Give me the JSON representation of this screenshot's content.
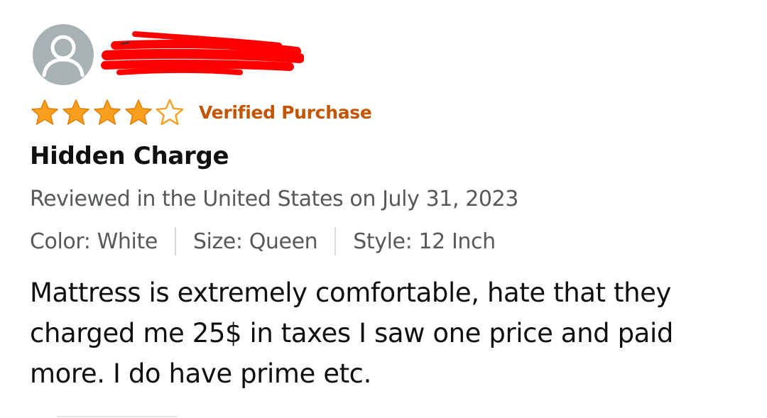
{
  "review": {
    "rating": 4,
    "rating_max": 5,
    "verified_label": "Verified Purchase",
    "title": "Hidden Charge",
    "reviewed_line": "Reviewed in the United States on July 31, 2023",
    "variations": {
      "color": "Color: White",
      "size": "Size: Queen",
      "style": "Style: 12 Inch"
    },
    "body": "Mattress is extremely comfortable, hate that they charged me 25$ in taxes I saw one price and paid more. I do have prime etc."
  },
  "colors": {
    "star": "#f7a01f",
    "verified": "#c45500",
    "secondary_text": "#565959",
    "redaction": "#ff0000",
    "avatar_bg": "#a8b1b3"
  },
  "icons": {
    "avatar": "default-user-icon",
    "star_filled": "star-filled-icon",
    "star_empty": "star-empty-icon"
  }
}
